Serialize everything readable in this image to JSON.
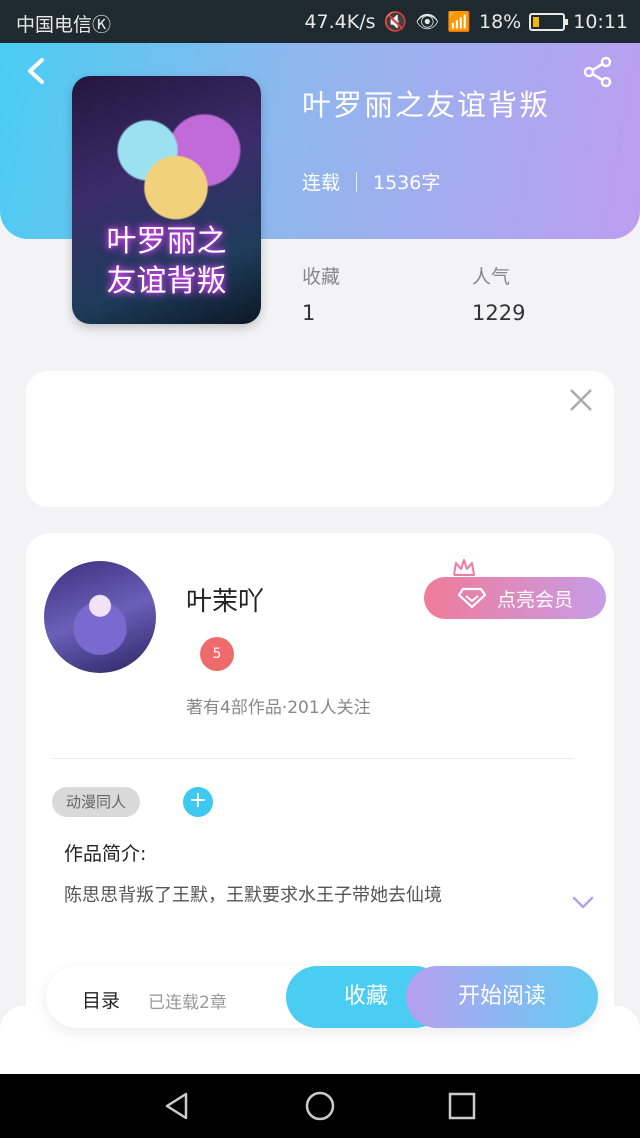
{
  "status_bar": {
    "carrier": "中国电信Ⓚ",
    "speed": "47.4K/s",
    "battery": "18%",
    "time": "10:11"
  },
  "book": {
    "title": "叶罗丽之友谊背叛",
    "status": "连载",
    "word_count": "1536字",
    "cover_title": "叶罗丽之\n友谊背叛",
    "stats": [
      {
        "label": "收藏",
        "value": "1"
      },
      {
        "label": "人气",
        "value": "1229"
      }
    ]
  },
  "author": {
    "name": "叶茉吖",
    "level_badge": "5",
    "stats_text": "著有4部作品·201人关注",
    "vip_label": "点亮会员"
  },
  "tags": [
    "动漫同人"
  ],
  "intro": {
    "label": "作品简介:",
    "text": "陈思思背叛了王默，王默要求水王子带她去仙境"
  },
  "actions": {
    "toc_label": "目录",
    "toc_sub": "已连载2章",
    "collect_label": "收藏",
    "read_label": "开始阅读"
  },
  "colors": {
    "accent_blue": "#49cdf2",
    "accent_purple": "#bd9ef0",
    "vip_pink": "#f07b9a"
  }
}
